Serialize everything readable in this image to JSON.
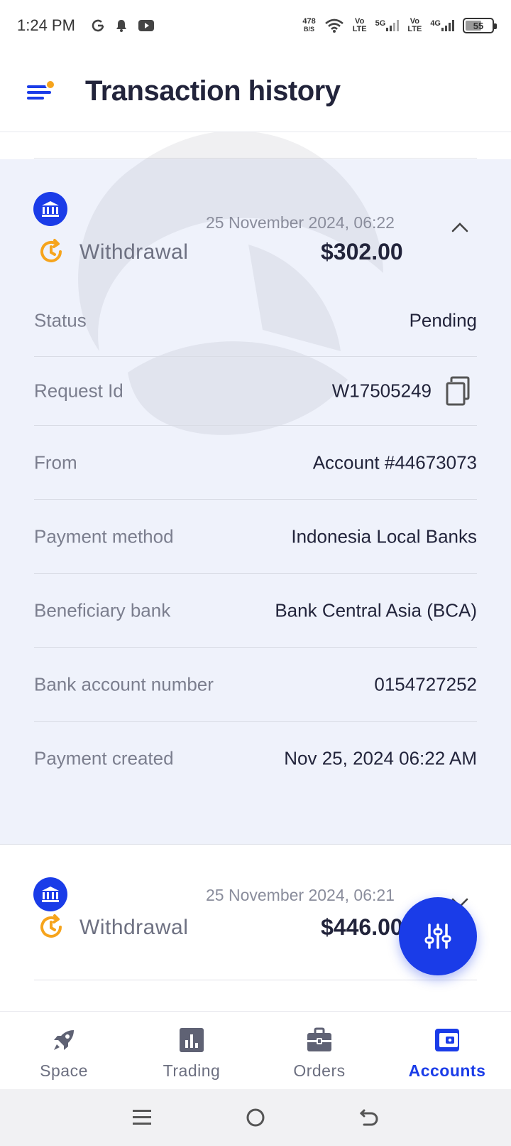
{
  "status_bar": {
    "time": "1:24 PM",
    "net_speed_value": "478",
    "net_speed_unit": "B/S",
    "vo_top": "Vo",
    "vo_bottom": "LTE",
    "sig1_label": "5G",
    "sig2_label": "4G",
    "battery": "55"
  },
  "header": {
    "title": "Transaction history"
  },
  "transactions": [
    {
      "date": "25 November 2024, 06:22",
      "type": "Withdrawal",
      "amount": "$302.00",
      "details": [
        {
          "label": "Status",
          "value": "Pending"
        },
        {
          "label": "Request Id",
          "value": "W17505249"
        },
        {
          "label": "From",
          "value": "Account #44673073"
        },
        {
          "label": "Payment method",
          "value": "Indonesia Local Banks"
        },
        {
          "label": "Beneficiary bank",
          "value": "Bank Central Asia (BCA)"
        },
        {
          "label": "Bank account number",
          "value": "0154727252"
        },
        {
          "label": "Payment created",
          "value": "Nov 25, 2024 06:22 AM"
        }
      ]
    },
    {
      "date": "25 November 2024, 06:21",
      "type": "Withdrawal",
      "amount": "$446.00"
    }
  ],
  "bottom_nav": {
    "items": [
      {
        "label": "Space",
        "icon": "rocket-icon"
      },
      {
        "label": "Trading",
        "icon": "chart-icon"
      },
      {
        "label": "Orders",
        "icon": "briefcase-icon"
      },
      {
        "label": "Accounts",
        "icon": "wallet-icon",
        "active": true
      }
    ]
  },
  "colors": {
    "accent": "#1a3ce8",
    "pending_orange": "#f6a41c",
    "expanded_bg": "#eff2fb"
  }
}
